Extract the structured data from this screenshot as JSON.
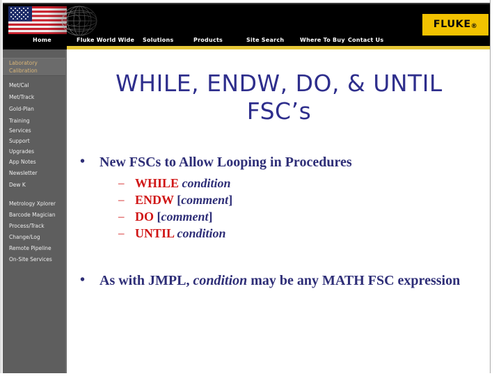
{
  "header": {
    "logo_text": "FLUKE",
    "logo_registered": "®",
    "banner_alt": "us-flag-globe-banner",
    "nav_items": [
      {
        "label": "Home",
        "name": "nav-home"
      },
      {
        "label": "Fluke World Wide",
        "name": "nav-fluke-world-wide"
      },
      {
        "label": "Solutions",
        "name": "nav-solutions"
      },
      {
        "label": "Products",
        "name": "nav-products"
      },
      {
        "label": "Site Search",
        "name": "nav-site-search"
      },
      {
        "label": "Where To Buy",
        "name": "nav-where-to-buy"
      },
      {
        "label": "Contact Us",
        "name": "nav-contact-us"
      }
    ]
  },
  "sidebar": {
    "highlight": "Laboratory\nCalibration",
    "group_one": [
      "Met/Cal",
      "Met/Track",
      "Gold-Plan",
      "Training",
      "Services",
      "Support",
      "Upgrades",
      "App Notes",
      "Newsletter",
      "Dew K"
    ],
    "group_two": [
      "Metrology Xplorer",
      "Barcode Magician",
      "Process/Track",
      "Change/Log",
      "Remote Pipeline",
      "On-Site Services"
    ]
  },
  "slide": {
    "title_line1": "WHILE, ENDW, DO, & UNTIL",
    "title_line2": "FSC’s",
    "bullet_glyph": "•",
    "dash_glyph": "–",
    "bullet1": "New FSCs to Allow Looping in Procedures",
    "sub_bullets": [
      {
        "keyword": "WHILE",
        "arg_open": "",
        "arg": "condition",
        "arg_close": ""
      },
      {
        "keyword": "ENDW",
        "arg_open": "[",
        "arg": "comment",
        "arg_close": "]"
      },
      {
        "keyword": "DO",
        "arg_open": "[",
        "arg": "comment",
        "arg_close": "]"
      },
      {
        "keyword": "UNTIL",
        "arg_open": "",
        "arg": "condition",
        "arg_close": ""
      }
    ],
    "bullet2_part1": "As with JMPL, ",
    "bullet2_italic": "condition",
    "bullet2_part2": " may be any MATH FSC expression"
  },
  "colors": {
    "header_bg": "#000000",
    "accent_yellow": "#e6c737",
    "sidebar_bg": "#5e5e5e",
    "title_blue": "#2e2e8c",
    "body_blue": "#2e2e77",
    "keyword_red": "#d01616",
    "sidebar_highlight_text": "#d8b477"
  }
}
